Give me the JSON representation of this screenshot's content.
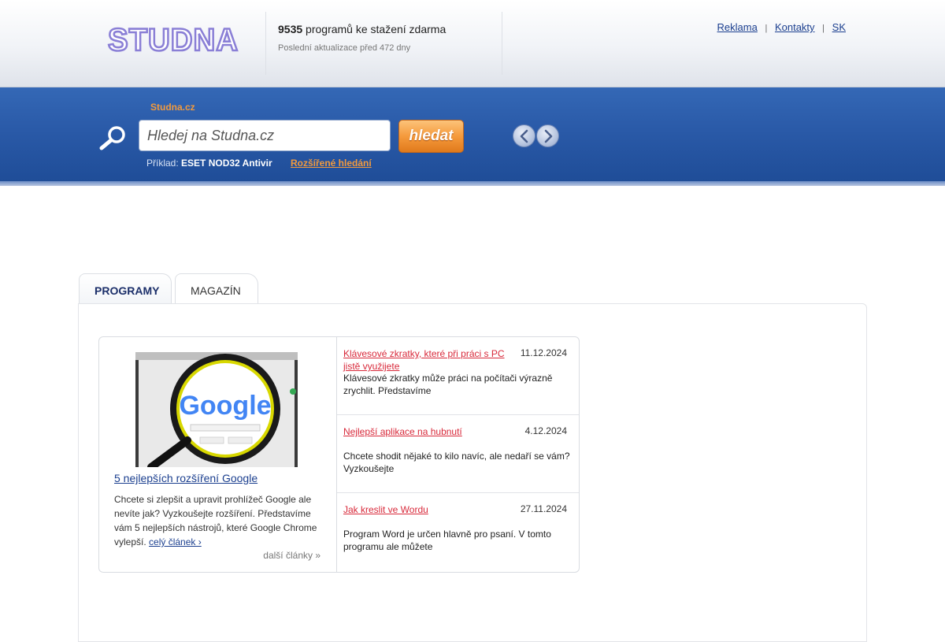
{
  "header": {
    "logo_text": "STUDNA",
    "program_count": "9535",
    "program_count_suffix": " programů ke stažení zdarma",
    "last_update": "Poslední aktualizace před 472 dny",
    "links": [
      {
        "label": "Reklama"
      },
      {
        "label": "Kontakty"
      },
      {
        "label": "SK"
      }
    ],
    "separator": "|"
  },
  "search": {
    "site_name": "Studna.cz",
    "placeholder": "Hledej na Studna.cz",
    "button_label": "hledat",
    "example_label": "Příklad:",
    "example_value": "ESET NOD32 Antivir",
    "advanced_link": "Rozšířené hledání"
  },
  "tabs": [
    {
      "label": "PROGRAMY",
      "active": true
    },
    {
      "label": "MAGAZÍN",
      "active": false
    }
  ],
  "featured": {
    "image_text": "Google",
    "title": "5 nejlepších rozšíření Google",
    "description": "Chcete si zlepšit a upravit prohlížeč Google ale nevíte jak? Vyzkoušejte rozšíření. Představíme vám 5 nejlepších nástrojů, které Google Chrome vylepší.",
    "read_more": "celý článek ›",
    "more_articles": "další články »"
  },
  "articles": [
    {
      "title": "Klávesové zkratky, které při práci s PC jistě využijete",
      "date": "11.12.2024",
      "desc": "Klávesové zkratky může práci na počítači výrazně zrychlit. Představíme"
    },
    {
      "title": "Nejlepší aplikace na hubnutí",
      "date": "4.12.2024",
      "desc": "Chcete shodit nějaké to kilo navíc, ale nedaří se vám? Vyzkoušejte"
    },
    {
      "title": "Jak kreslit ve Wordu",
      "date": "27.11.2024",
      "desc": "Program Word je určen hlavně pro psaní. V tomto programu ale můžete"
    }
  ],
  "colors": {
    "band_blue": "#2a5aa8",
    "accent_orange": "#f29a3d",
    "link_blue": "#1b3f8f",
    "article_red": "#d8293a",
    "logo_purple": "#8a7fd6"
  }
}
